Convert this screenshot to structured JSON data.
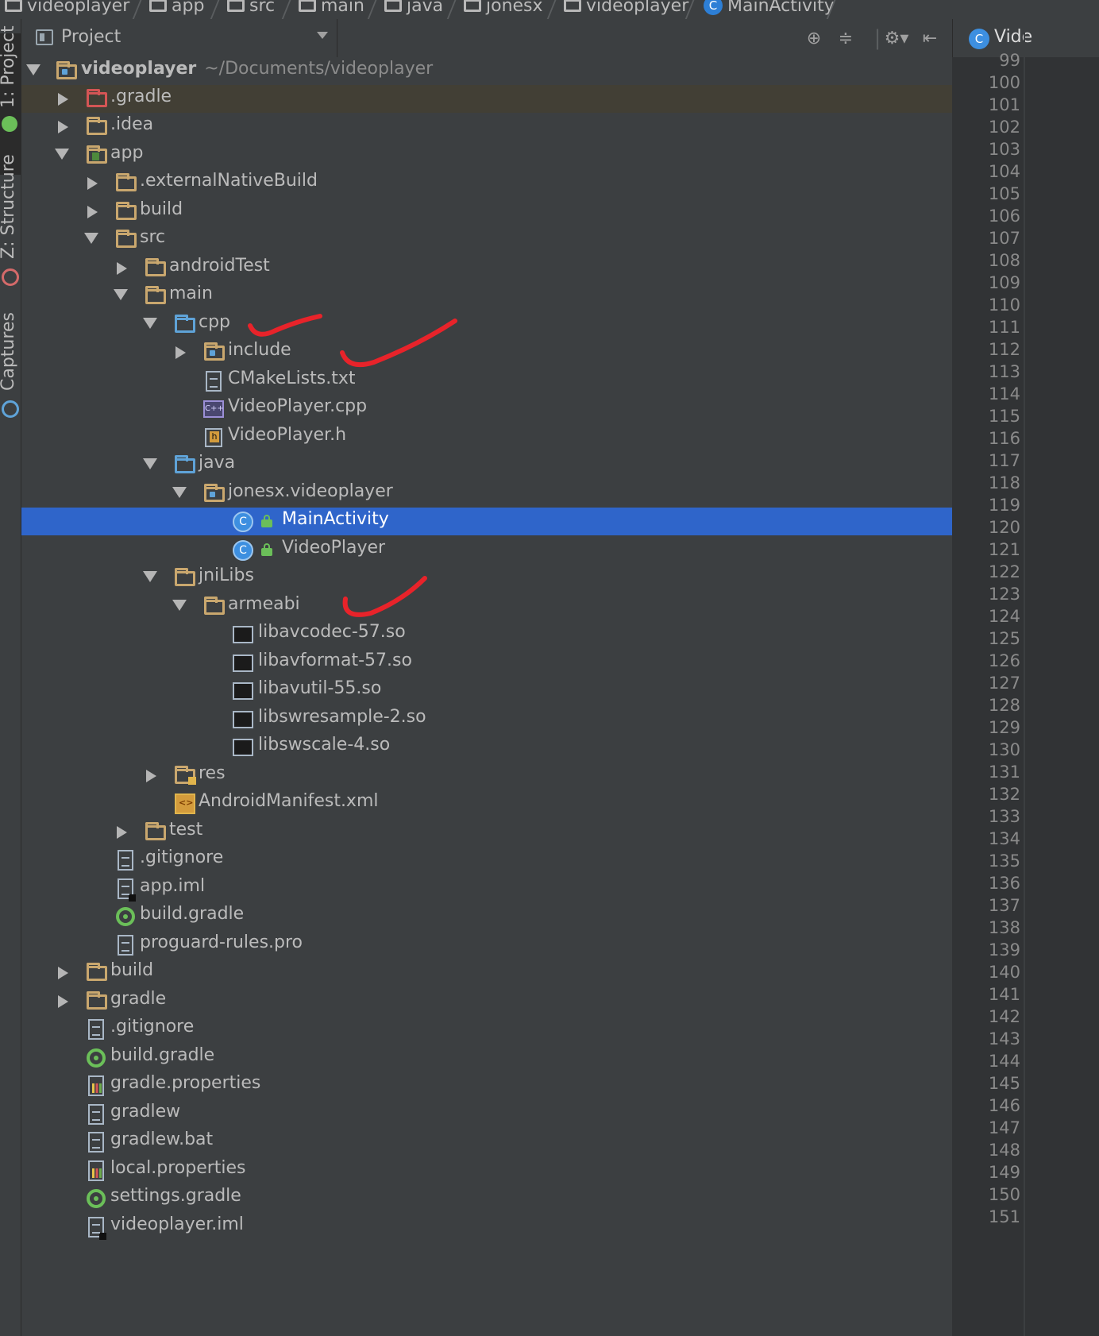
{
  "breadcrumb": [
    {
      "label": "videoplayer",
      "icon": "module-folder-icon"
    },
    {
      "label": "app",
      "icon": "module-folder-icon"
    },
    {
      "label": "src",
      "icon": "folder-icon"
    },
    {
      "label": "main",
      "icon": "folder-icon"
    },
    {
      "label": "java",
      "icon": "folder-icon"
    },
    {
      "label": "jonesx",
      "icon": "package-icon"
    },
    {
      "label": "videoplayer",
      "icon": "package-icon"
    },
    {
      "label": "MainActivity",
      "icon": "class-icon"
    }
  ],
  "tool_stripe": {
    "project_tab": "1: Project",
    "structure_tab": "Z: Structure",
    "captures_tab": "Captures"
  },
  "project_panel": {
    "title": "Project",
    "view_mode": "Project"
  },
  "editor_tab": {
    "label": "Vide",
    "icon": "C"
  },
  "tree": {
    "root_label": "videoplayer",
    "root_path": "~/Documents/videoplayer",
    "items": [
      {
        "label": ".gradle"
      },
      {
        "label": ".idea"
      },
      {
        "label": "app"
      },
      {
        "label": ".externalNativeBuild"
      },
      {
        "label": "build"
      },
      {
        "label": "src"
      },
      {
        "label": "androidTest"
      },
      {
        "label": "main"
      },
      {
        "label": "cpp"
      },
      {
        "label": "include"
      },
      {
        "label": "CMakeLists.txt"
      },
      {
        "label": "VideoPlayer.cpp"
      },
      {
        "label": "VideoPlayer.h"
      },
      {
        "label": "java"
      },
      {
        "label": "jonesx.videoplayer"
      },
      {
        "label": "MainActivity"
      },
      {
        "label": "VideoPlayer"
      },
      {
        "label": "jniLibs"
      },
      {
        "label": "armeabi"
      },
      {
        "label": "libavcodec-57.so"
      },
      {
        "label": "libavformat-57.so"
      },
      {
        "label": "libavutil-55.so"
      },
      {
        "label": "libswresample-2.so"
      },
      {
        "label": "libswscale-4.so"
      },
      {
        "label": "res"
      },
      {
        "label": "AndroidManifest.xml"
      },
      {
        "label": "test"
      },
      {
        "label": ".gitignore"
      },
      {
        "label": "app.iml"
      },
      {
        "label": "build.gradle"
      },
      {
        "label": "proguard-rules.pro"
      },
      {
        "label": "build"
      },
      {
        "label": "gradle"
      },
      {
        "label": ".gitignore"
      },
      {
        "label": "build.gradle"
      },
      {
        "label": "gradle.properties"
      },
      {
        "label": "gradlew"
      },
      {
        "label": "gradlew.bat"
      },
      {
        "label": "local.properties"
      },
      {
        "label": "settings.gradle"
      },
      {
        "label": "videoplayer.iml"
      }
    ]
  },
  "line_numbers": [
    "99",
    "100",
    "101",
    "102",
    "103",
    "104",
    "105",
    "106",
    "107",
    "108",
    "109",
    "110",
    "111",
    "112",
    "113",
    "114",
    "115",
    "116",
    "117",
    "118",
    "119",
    "120",
    "121",
    "122",
    "123",
    "124",
    "125",
    "126",
    "127",
    "128",
    "129",
    "130",
    "131",
    "132",
    "133",
    "134",
    "135",
    "136",
    "137",
    "138",
    "139",
    "140",
    "141",
    "142",
    "143",
    "144",
    "145",
    "146",
    "147",
    "148",
    "149",
    "150",
    "151"
  ],
  "colors": {
    "selection": "#2f65ca",
    "annotation": "#e8232a",
    "background": "#3c3f41"
  }
}
